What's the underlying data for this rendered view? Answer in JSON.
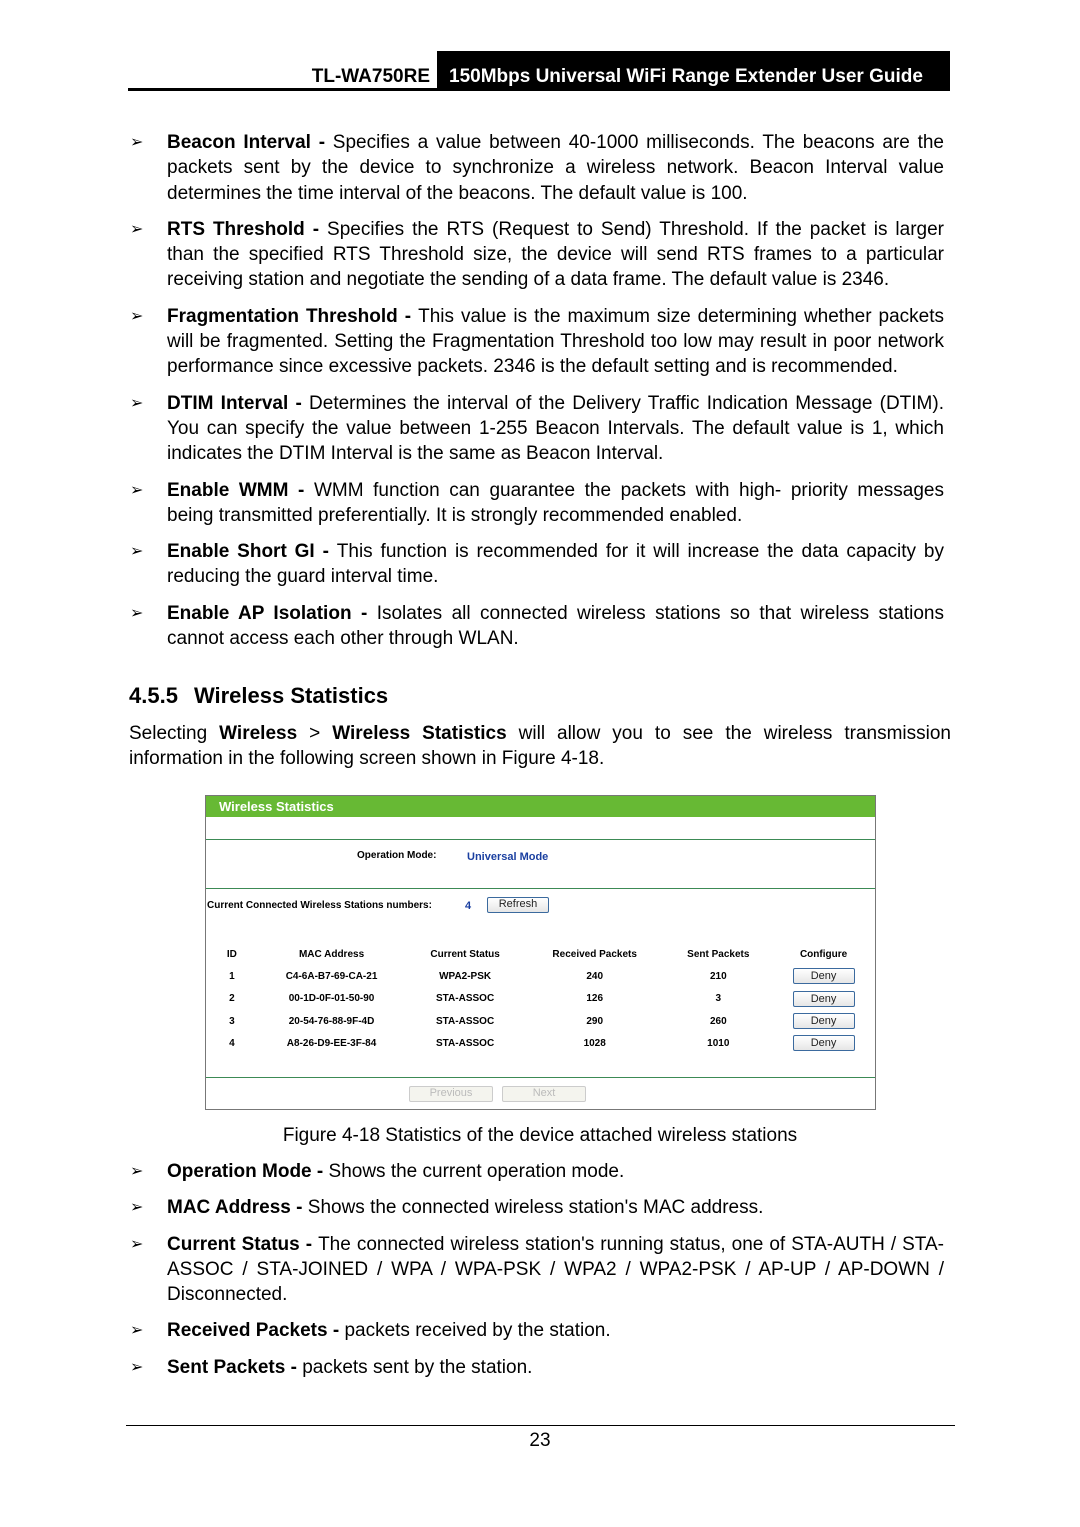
{
  "header": {
    "model": "TL-WA750RE",
    "title": "150Mbps Universal WiFi Range Extender User Guide"
  },
  "bullets_top": [
    {
      "term": "Beacon Interval",
      "sep": " - ",
      "text": "Specifies a value between 40-1000 milliseconds. The beacons are the packets sent by the device to synchronize a wireless network. Beacon Interval value determines the time interval of the beacons. The default value is 100."
    },
    {
      "term": "RTS Threshold",
      "sep": " - ",
      "text": "Specifies the RTS (Request to Send) Threshold. If the packet is larger than the specified RTS Threshold size, the device will send RTS frames to a particular receiving station and negotiate the sending of a data frame. The default value is 2346."
    },
    {
      "term": "Fragmentation Threshold",
      "sep": " - ",
      "text": "This value is the maximum size determining whether packets will be fragmented. Setting the Fragmentation Threshold too low may result in poor network performance since excessive packets. 2346 is the default setting and is recommended."
    },
    {
      "term": "DTIM Interval",
      "sep": " - ",
      "text": "Determines the interval of the Delivery Traffic Indication Message (DTIM). You can specify the value between 1-255 Beacon Intervals. The default value is 1, which indicates the DTIM Interval is the same as Beacon Interval."
    },
    {
      "term": "Enable WMM",
      "sep": " - ",
      "text": "WMM function can guarantee the packets with high- priority messages being transmitted preferentially. It is strongly recommended enabled."
    },
    {
      "term": "Enable Short GI",
      "sep": " - ",
      "text": "This function is recommended for it will increase the data capacity by reducing the guard interval time."
    },
    {
      "term": "Enable AP Isolation",
      "sep": " - ",
      "text": "Isolates all connected wireless stations so that wireless stations cannot access each other through WLAN."
    }
  ],
  "section": {
    "number": "4.5.5",
    "title": "Wireless Statistics"
  },
  "intro": {
    "pre": "Selecting ",
    "menu1": "Wireless",
    "gt": " > ",
    "menu2": "Wireless Statistics",
    "post": " will allow you to see the wireless transmission information in the following screen shown in Figure 4-18."
  },
  "figure": {
    "title": "Wireless Statistics",
    "op_mode_label": "Operation Mode:",
    "op_mode_value": "Universal Mode",
    "stations_label": "Current Connected Wireless Stations numbers:",
    "stations_count": "4",
    "refresh": "Refresh",
    "columns": [
      "ID",
      "MAC Address",
      "Current Status",
      "Received Packets",
      "Sent Packets",
      "Configure"
    ],
    "rows": [
      {
        "id": "1",
        "mac": "C4-6A-B7-69-CA-21",
        "status": "WPA2-PSK",
        "rx": "240",
        "tx": "210",
        "action": "Deny"
      },
      {
        "id": "2",
        "mac": "00-1D-0F-01-50-90",
        "status": "STA-ASSOC",
        "rx": "126",
        "tx": "3",
        "action": "Deny"
      },
      {
        "id": "3",
        "mac": "20-54-76-88-9F-4D",
        "status": "STA-ASSOC",
        "rx": "290",
        "tx": "260",
        "action": "Deny"
      },
      {
        "id": "4",
        "mac": "A8-26-D9-EE-3F-84",
        "status": "STA-ASSOC",
        "rx": "1028",
        "tx": "1010",
        "action": "Deny"
      }
    ],
    "previous": "Previous",
    "next": "Next",
    "colors": {
      "title_bar": "#67b934",
      "value_text": "#1a3fa0"
    }
  },
  "caption": "Figure 4-18 Statistics of the device attached wireless stations",
  "bullets_bottom": [
    {
      "term": "Operation Mode",
      "sep": " - ",
      "text": "Shows the current operation mode."
    },
    {
      "term": "MAC Address",
      "sep": " - ",
      "text": "Shows the connected wireless station's MAC address."
    },
    {
      "term": "Current Status",
      "sep": " - ",
      "text": "The connected wireless station's running status, one of STA-AUTH / STA-ASSOC / STA-JOINED / WPA / WPA-PSK / WPA2 / WPA2-PSK / AP-UP / AP-DOWN / Disconnected."
    },
    {
      "term": "Received Packets",
      "sep": " - ",
      "text": "packets received by the station."
    },
    {
      "term": "Sent Packets",
      "sep": " - ",
      "text": "packets sent by the station."
    }
  ],
  "page_number": "23"
}
